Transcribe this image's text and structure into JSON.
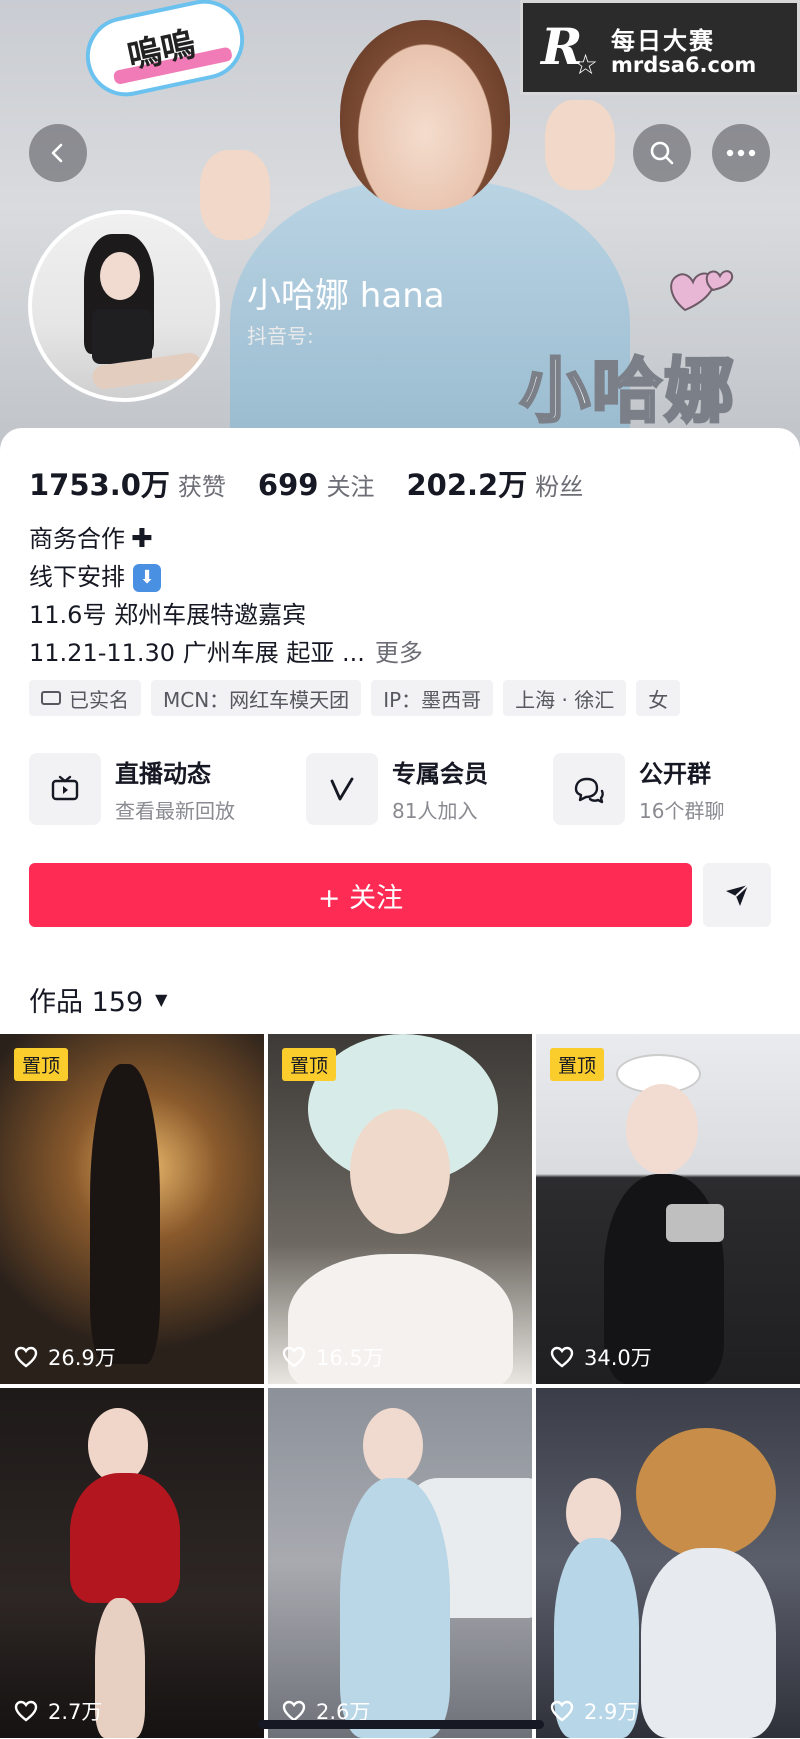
{
  "watermark": {
    "logo": "R",
    "name": "每日大赛",
    "site": "mrdsa6.com"
  },
  "banner": {
    "sticker_text": "嗚嗚",
    "big_name": "小哈娜"
  },
  "profile": {
    "nickname": "小哈娜 hana",
    "douyin_id_label": "抖音号:"
  },
  "stats": [
    {
      "value": "1753.0万",
      "label": "获赞"
    },
    {
      "value": "699",
      "label": "关注"
    },
    {
      "value": "202.2万",
      "label": "粉丝"
    }
  ],
  "bio": {
    "line1": "商务合作",
    "line2": "线下安排",
    "line3": "11.6号 郑州车展特邀嘉宾",
    "line4": "11.21-11.30 广州车展 起亚 ...",
    "more": "更多"
  },
  "tags": [
    "已实名",
    "MCN：网红车模天团",
    "IP：墨西哥",
    "上海 · 徐汇",
    "女"
  ],
  "features": [
    {
      "title": "直播动态",
      "subtitle": "查看最新回放",
      "icon": "tv-icon"
    },
    {
      "title": "专属会员",
      "subtitle": "81人加入",
      "icon": "v-icon"
    },
    {
      "title": "公开群",
      "subtitle": "16个群聊",
      "icon": "chat-bubbles-icon"
    }
  ],
  "actions": {
    "follow_label": "+ 关注"
  },
  "works": {
    "label": "作品 159"
  },
  "grid": [
    {
      "pinned": true,
      "pin_label": "置顶",
      "likes": "26.9万",
      "bg": "#3b2f25"
    },
    {
      "pinned": true,
      "pin_label": "置顶",
      "likes": "16.5万",
      "bg": "#6b6660"
    },
    {
      "pinned": true,
      "pin_label": "置顶",
      "likes": "34.0万",
      "bg": "#2a2a2c"
    },
    {
      "pinned": false,
      "pin_label": "",
      "likes": "2.7万",
      "bg": "#1f1b1a"
    },
    {
      "pinned": false,
      "pin_label": "",
      "likes": "2.6万",
      "bg": "#8b8f96"
    },
    {
      "pinned": false,
      "pin_label": "",
      "likes": "2.9万",
      "bg": "#4a4d57"
    }
  ],
  "colors": {
    "accent": "#fe2c55",
    "pin": "#facd2d"
  }
}
